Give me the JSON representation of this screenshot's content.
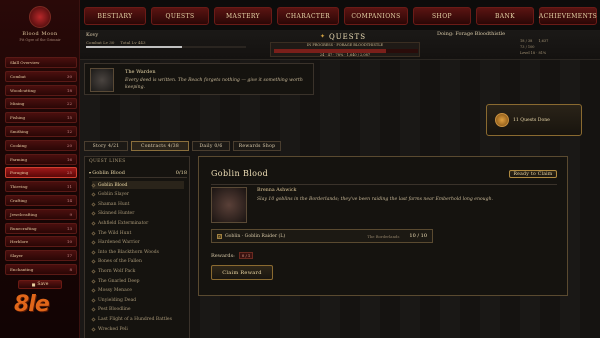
{
  "nav": {
    "items": [
      "Bestiary",
      "Quests",
      "Mastery",
      "Character",
      "Companions",
      "Shop",
      "Bank",
      "Achievements"
    ]
  },
  "sidebar": {
    "title": "Blood Moon",
    "subtitle": "Pit Ogre of the Grimnir",
    "skills": [
      {
        "label": "Skill Overview",
        "level": ""
      },
      {
        "label": "Combat",
        "level": "30"
      },
      {
        "label": "Woodcutting",
        "level": "18"
      },
      {
        "label": "Mining",
        "level": "22"
      },
      {
        "label": "Fishing",
        "level": "15"
      },
      {
        "label": "Smithing",
        "level": "12"
      },
      {
        "label": "Cooking",
        "level": "20"
      },
      {
        "label": "Farming",
        "level": "16"
      },
      {
        "label": "Foraging",
        "level": "25"
      },
      {
        "label": "Thieving",
        "level": "11"
      },
      {
        "label": "Crafting",
        "level": "14"
      },
      {
        "label": "Jewelcrafting",
        "level": "9"
      },
      {
        "label": "Runecrafting",
        "level": "13"
      },
      {
        "label": "Herblore",
        "level": "10"
      },
      {
        "label": "Slayer",
        "level": "17"
      },
      {
        "label": "Enchanting",
        "level": "8"
      }
    ],
    "save_label": "Save"
  },
  "header": {
    "player": "Kovy",
    "combat_lv": "Combat Lv 30",
    "total_lv": "Total Lv 443",
    "title": "Quests",
    "subtitle": "In Progress · Forage Bloodthistle",
    "progress_text": "24 · 47 · 78% · 1,640 / 2,087",
    "doing": "Doing: Forage Bloodthistle",
    "stat1": "18 / 38",
    "stat2": "1,637",
    "stat3": "73 / 100",
    "stat4": "Level 18 · 81%"
  },
  "dialog": {
    "speaker": "The Warden",
    "text": "Every deed is written. The Reach forgets nothing — give it something worth keeping."
  },
  "quest_toast": {
    "label": "11 Quests Done"
  },
  "tabs": [
    {
      "label": "Story 4/21"
    },
    {
      "label": "Contracts 4/38"
    },
    {
      "label": "Daily 0/6"
    },
    {
      "label": "Rewards Shop"
    }
  ],
  "quest_list": {
    "header": "Quest Lines",
    "group": "Goblin Blood",
    "group_count": "0/18",
    "items": [
      "Goblin Blood",
      "Goblin Slayer",
      "Shaman Hunt",
      "Skinned Hunter",
      "Ashfield Exterminator",
      "The Wild Hunt",
      "Hardened Warrior",
      "Into the Blackthorn Woods",
      "Bones of the Fallen",
      "Thorn Wolf Pack",
      "The Gnarled Deep",
      "Mossy Menace",
      "Unyielding Dead",
      "Pest Bloodline",
      "Last Flight of a Hundred Battles",
      "Wrecked Peli"
    ]
  },
  "detail": {
    "title": "Goblin Blood",
    "ready_label": "Ready to Claim",
    "npc": "Brenna Ashwick",
    "text": "Slay 10 goblins in the Borderlands; they've been raiding the last farms near Emberhold long enough.",
    "objective": "Goblin · Goblin Raider (L)",
    "objective_location": "The Borderlands",
    "objective_progress": "10 / 10",
    "rewards_label": "Rewards:",
    "rewards_value": "0 / 1",
    "claim_label": "Claim Reward"
  },
  "watermark": {
    "text": "8le"
  }
}
